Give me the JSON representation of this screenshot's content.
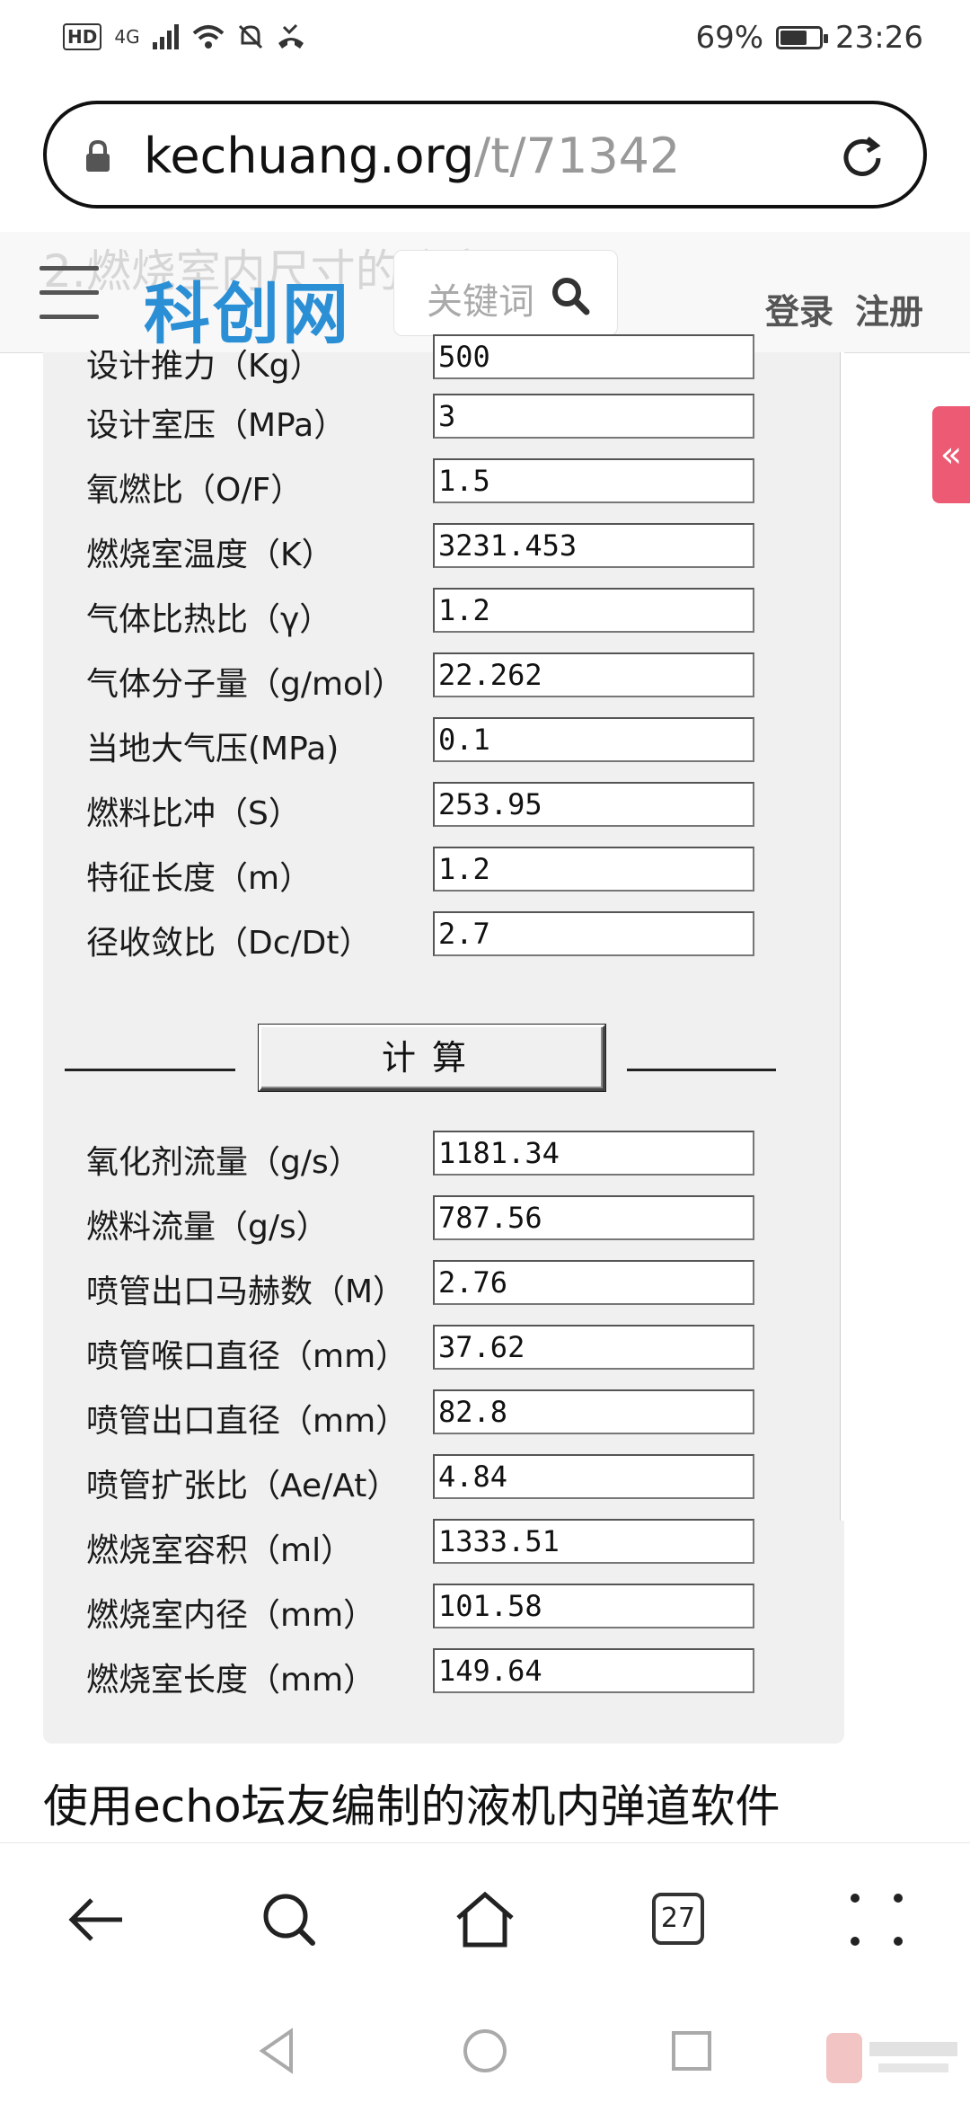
{
  "status_bar": {
    "hd": "HD",
    "network": "4G",
    "battery": "69%",
    "time": "23:26"
  },
  "browser": {
    "url_domain": "kechuang.org",
    "url_path": "/t/71342"
  },
  "site": {
    "logo": "科创网",
    "search_placeholder": "关键词",
    "login": "登录",
    "register": "注册",
    "ghost_heading": "2.燃烧室内尺寸的确定"
  },
  "side_tab": {
    "label": "«"
  },
  "calculator": {
    "partial_label": "设计推力（Kg）",
    "partial_value": "500",
    "inputs": [
      {
        "label": "设计室压（MPa）",
        "value": "3"
      },
      {
        "label": "氧燃比（O/F）",
        "value": "1.5"
      },
      {
        "label": "燃烧室温度（K）",
        "value": "3231.453"
      },
      {
        "label": "气体比热比（γ）",
        "value": "1.2"
      },
      {
        "label": "气体分子量（g/mol）",
        "value": "22.262"
      },
      {
        "label": "当地大气压(MPa)",
        "value": "0.1"
      },
      {
        "label": "燃料比冲（S）",
        "value": "253.95"
      },
      {
        "label": "特征长度（m）",
        "value": "1.2"
      },
      {
        "label": "径收敛比（Dc/Dt）",
        "value": "2.7"
      }
    ],
    "button": "计算",
    "outputs": [
      {
        "label": "氧化剂流量（g/s）",
        "value": "1181.34"
      },
      {
        "label": "燃料流量（g/s）",
        "value": "787.56"
      },
      {
        "label": "喷管出口马赫数（M）",
        "value": "2.76"
      },
      {
        "label": "喷管喉口直径（mm）",
        "value": "37.62"
      },
      {
        "label": "喷管出口直径（mm）",
        "value": "82.8"
      },
      {
        "label": "喷管扩张比（Ae/At）",
        "value": "4.84"
      },
      {
        "label": "燃烧室容积（ml）",
        "value": "1333.51"
      },
      {
        "label": "燃烧室内径（mm）",
        "value": "101.58"
      },
      {
        "label": "燃烧室长度（mm）",
        "value": "149.64"
      }
    ]
  },
  "caption": "使用echo坛友编制的液机内弹道软件",
  "toolbar": {
    "tabs_count": "27"
  },
  "colors": {
    "logo": "#2b8fd6",
    "side_tab": "#ec5a73"
  }
}
